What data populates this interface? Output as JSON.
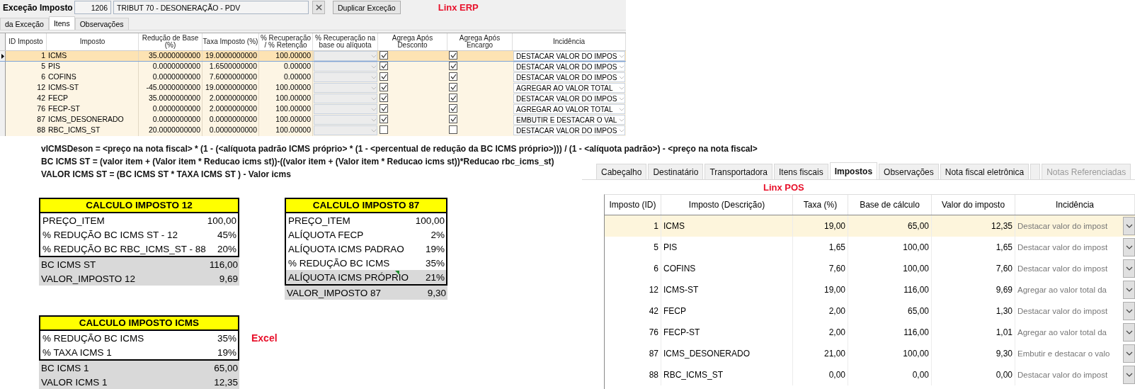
{
  "erp": {
    "title": "Exceção Imposto",
    "code": "1206",
    "description": "TRIBUT 70 - DESONERAÇÃO - PDV",
    "action": "Duplicar Exceção",
    "label": "Linx ERP",
    "tabs": [
      {
        "label": "da Exceção",
        "selected": false
      },
      {
        "label": "Itens",
        "selected": true
      },
      {
        "label": "Observações",
        "selected": false
      }
    ],
    "columns": [
      "ID Imposto",
      "Imposto",
      "Redução de Base (%)",
      "Taxa Imposto (%)",
      "% Recuperação / % Retenção",
      "% Recuperação na base ou alíquota",
      "Agrega Após Desconto",
      "Agrega Após Encargo",
      "Incidência"
    ],
    "rows": [
      {
        "id": "1",
        "name": "ICMS",
        "reducao": "35.0000000000",
        "taxa": "19.0000000000",
        "recuperacao": "100.00000",
        "agrega_desconto": true,
        "agrega_encargo": true,
        "incidencia": "DESTACAR VALOR DO IMPOS",
        "selected": true
      },
      {
        "id": "5",
        "name": "PIS",
        "reducao": "0.0000000000",
        "taxa": "1.6500000000",
        "recuperacao": "0.00000",
        "agrega_desconto": true,
        "agrega_encargo": true,
        "incidencia": "DESTACAR VALOR DO IMPOS",
        "selected": false
      },
      {
        "id": "6",
        "name": "COFINS",
        "reducao": "0.0000000000",
        "taxa": "7.6000000000",
        "recuperacao": "0.00000",
        "agrega_desconto": true,
        "agrega_encargo": true,
        "incidencia": "DESTACAR VALOR DO IMPOS",
        "selected": false
      },
      {
        "id": "12",
        "name": "ICMS-ST",
        "reducao": "-45.0000000000",
        "taxa": "19.0000000000",
        "recuperacao": "100.00000",
        "agrega_desconto": true,
        "agrega_encargo": true,
        "incidencia": "AGREGAR AO VALOR TOTAL",
        "selected": false
      },
      {
        "id": "42",
        "name": "FECP",
        "reducao": "35.0000000000",
        "taxa": "2.0000000000",
        "recuperacao": "100.00000",
        "agrega_desconto": true,
        "agrega_encargo": true,
        "incidencia": "DESTACAR VALOR DO IMPOS",
        "selected": false
      },
      {
        "id": "76",
        "name": "FECP-ST",
        "reducao": "0.0000000000",
        "taxa": "2.0000000000",
        "recuperacao": "100.00000",
        "agrega_desconto": true,
        "agrega_encargo": true,
        "incidencia": "AGREGAR AO VALOR TOTAL",
        "selected": false
      },
      {
        "id": "87",
        "name": "ICMS_DESONERADO",
        "reducao": "0.0000000000",
        "taxa": "0.0000000000",
        "recuperacao": "100.00000",
        "agrega_desconto": true,
        "agrega_encargo": true,
        "incidencia": "EMBUTIR E DESTACAR O VAL",
        "selected": false
      },
      {
        "id": "88",
        "name": "RBC_ICMS_ST",
        "reducao": "20.0000000000",
        "taxa": "0.0000000000",
        "recuperacao": "100.00000",
        "agrega_desconto": false,
        "agrega_encargo": false,
        "incidencia": "DESTACAR VALOR DO IMPOS",
        "selected": false
      }
    ]
  },
  "formulas": [
    "vICMSDeson = <preço na nota fiscal> * (1 - (<alíquota padrão ICMS próprio> * (1 - <percentual de redução da BC ICMS próprio>))) / (1 - <alíquota padrão>) - <preço na nota fiscal>",
    "BC ICMS ST = (valor item + (Valor item * Reducao icms st))-((valor item + (Valor item * Reducao icms st))*Reducao rbc_icms_st)",
    "VALOR ICMS ST = (BC ICMS ST * TAXA ICMS ST ) - Valor icms"
  ],
  "excel": {
    "label": "Excel",
    "tables": [
      {
        "title": "CALCULO IMPOSTO 12",
        "rows": [
          {
            "label": "PREÇO_ITEM",
            "value": "100,00",
            "kind": "input",
            "note": false
          },
          {
            "label": "% REDUÇÃO BC ICMS ST - 12",
            "value": "45%",
            "kind": "input",
            "note": false
          },
          {
            "label": "% REDUÇÃO BC RBC_ICMS_ST - 88",
            "value": "20%",
            "kind": "input",
            "note": false
          },
          {
            "label": "BC ICMS ST",
            "value": "116,00",
            "kind": "result",
            "note": false
          },
          {
            "label": "VALOR_IMPOSTO 12",
            "value": "9,69",
            "kind": "result",
            "note": false
          }
        ]
      },
      {
        "title": "CALCULO IMPOSTO 87",
        "rows": [
          {
            "label": "PREÇO_ITEM",
            "value": "100,00",
            "kind": "input",
            "note": false
          },
          {
            "label": "ALÍQUOTA FECP",
            "value": "2%",
            "kind": "input",
            "note": false
          },
          {
            "label": "ALÍQUOTA ICMS PADRAO",
            "value": "19%",
            "kind": "input",
            "note": false
          },
          {
            "label": "% REDUÇÃO BC ICMS",
            "value": "35%",
            "kind": "input",
            "note": false
          },
          {
            "label": "ALÍQUOTA ICMS PRÓPRIO",
            "value": "21%",
            "kind": "computed",
            "note": true
          },
          {
            "label": "VALOR_IMPOSTO 87",
            "value": "9,30",
            "kind": "result",
            "note": false
          }
        ]
      },
      {
        "title": "CALCULO IMPOSTO ICMS",
        "rows": [
          {
            "label": "% REDUÇÃO BC ICMS",
            "value": "35%",
            "kind": "input",
            "note": false
          },
          {
            "label": "% TAXA ICMS  1",
            "value": "19%",
            "kind": "input",
            "note": false
          },
          {
            "label": "BC ICMS 1",
            "value": "65,00",
            "kind": "result",
            "note": false
          },
          {
            "label": "VALOR ICMS 1",
            "value": "12,35",
            "kind": "result",
            "note": false
          }
        ]
      }
    ]
  },
  "pos": {
    "label": "Linx POS",
    "tabs": [
      {
        "label": "Cabeçalho",
        "selected": false,
        "disabled": false
      },
      {
        "label": "Destinatário",
        "selected": false,
        "disabled": false
      },
      {
        "label": "Transportadora",
        "selected": false,
        "disabled": false
      },
      {
        "label": "Itens fiscais",
        "selected": false,
        "disabled": false
      },
      {
        "label": "Impostos",
        "selected": true,
        "disabled": false
      },
      {
        "label": "Observações",
        "selected": false,
        "disabled": false
      },
      {
        "label": "Nota fiscal eletrônica",
        "selected": false,
        "disabled": false
      },
      {
        "label": "Notas Referenciadas",
        "selected": false,
        "disabled": true
      }
    ],
    "columns": [
      "Imposto (ID)",
      "Imposto (Descrição)",
      "Taxa (%)",
      "Base de cálculo",
      "Valor do imposto",
      "Incidência"
    ],
    "rows": [
      {
        "id": "1",
        "name": "ICMS",
        "taxa": "19,00",
        "base": "65,00",
        "valor": "12,35",
        "incidencia": "Destacar valor do impost",
        "selected": true
      },
      {
        "id": "5",
        "name": "PIS",
        "taxa": "1,65",
        "base": "100,00",
        "valor": "1,65",
        "incidencia": "Destacar valor do impost",
        "selected": false
      },
      {
        "id": "6",
        "name": "COFINS",
        "taxa": "7,60",
        "base": "100,00",
        "valor": "7,60",
        "incidencia": "Destacar valor do impost",
        "selected": false
      },
      {
        "id": "12",
        "name": "ICMS-ST",
        "taxa": "19,00",
        "base": "116,00",
        "valor": "9,69",
        "incidencia": "Agregar ao valor total da",
        "selected": false
      },
      {
        "id": "42",
        "name": "FECP",
        "taxa": "2,00",
        "base": "65,00",
        "valor": "1,30",
        "incidencia": "Destacar valor do impost",
        "selected": false
      },
      {
        "id": "76",
        "name": "FECP-ST",
        "taxa": "2,00",
        "base": "116,00",
        "valor": "1,01",
        "incidencia": "Agregar ao valor total da",
        "selected": false
      },
      {
        "id": "87",
        "name": "ICMS_DESONERADO",
        "taxa": "21,00",
        "base": "100,00",
        "valor": "9,30",
        "incidencia": "Embutir e destacar o valo",
        "selected": false
      },
      {
        "id": "88",
        "name": "RBC_ICMS_ST",
        "taxa": "0,00",
        "base": "0,00",
        "valor": "0,00",
        "incidencia": "Destacar valor do impost",
        "selected": false
      }
    ]
  }
}
